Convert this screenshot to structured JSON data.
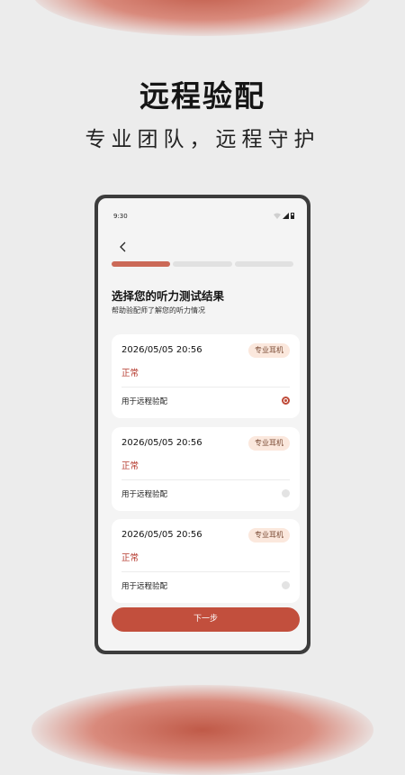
{
  "hero": {
    "title": "远程验配",
    "subtitle": "专业团队，远程守护"
  },
  "status_bar": {
    "time": "9:30",
    "icons": [
      "wifi-icon",
      "signal-icon",
      "battery-icon"
    ]
  },
  "progress": {
    "total_steps": 3,
    "completed_steps": 1
  },
  "page": {
    "title": "选择您的听力测试结果",
    "subtitle": "帮助验配师了解您的听力情况"
  },
  "results": [
    {
      "date": "2026/05/05 20:56",
      "badge": "专业耳机",
      "status": "正常",
      "usage": "用于远程验配",
      "selected": true
    },
    {
      "date": "2026/05/05 20:56",
      "badge": "专业耳机",
      "status": "正常",
      "usage": "用于远程验配",
      "selected": false
    },
    {
      "date": "2026/05/05 20:56",
      "badge": "专业耳机",
      "status": "正常",
      "usage": "用于远程验配",
      "selected": false
    }
  ],
  "next_button": {
    "label": "下一步"
  },
  "colors": {
    "accent": "#c24f3d",
    "status_text": "#b4372b",
    "badge_bg": "#fbe8dd",
    "progress_done": "#cb6957"
  }
}
